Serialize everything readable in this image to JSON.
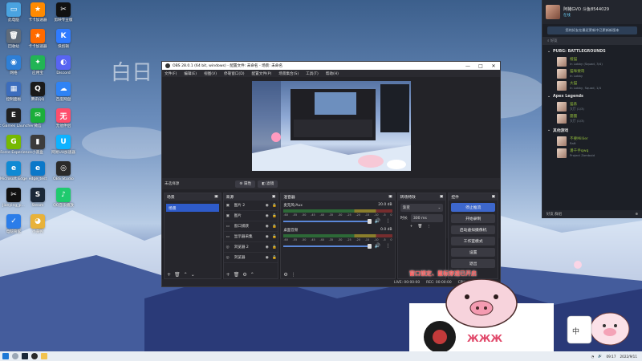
{
  "desktop": {
    "icons": [
      {
        "label": "此电脑",
        "color": "#4aa3e0",
        "glyph": "▭"
      },
      {
        "label": "卡卡加速器",
        "color": "#ff8a00",
        "glyph": "★"
      },
      {
        "label": "剪映专业版",
        "color": "#111111",
        "glyph": "✂"
      },
      {
        "label": "回收站",
        "color": "#5f6b7a",
        "glyph": "🗑"
      },
      {
        "label": "卡卡加速器",
        "color": "#ff6a00",
        "glyph": "★"
      },
      {
        "label": "快剪辑",
        "color": "#2f7bff",
        "glyph": "K"
      },
      {
        "label": "网络",
        "color": "#2e7fd6",
        "glyph": "◉"
      },
      {
        "label": "应用宝",
        "color": "#22b455",
        "glyph": "✦"
      },
      {
        "label": "Discord",
        "color": "#5865f2",
        "glyph": "◐"
      },
      {
        "label": "控制面板",
        "color": "#3c6dbd",
        "glyph": "▦"
      },
      {
        "label": "腾讯QQ",
        "color": "#1a1a1a",
        "glyph": "Q"
      },
      {
        "label": "百度网盘",
        "color": "#2f83f5",
        "glyph": "☁"
      },
      {
        "label": "Epic Games Launcher",
        "color": "#202020",
        "glyph": "E"
      },
      {
        "label": "微信",
        "color": "#1bae3a",
        "glyph": "✉"
      },
      {
        "label": "无他伴侣",
        "color": "#ff4d6b",
        "glyph": "无"
      },
      {
        "label": "GeForce Experience",
        "color": "#76b900",
        "glyph": "G"
      },
      {
        "label": "小黑盒",
        "color": "#3c3c3c",
        "glyph": "▮"
      },
      {
        "label": "网易UU加速器",
        "color": "#0db2ff",
        "glyph": "U"
      },
      {
        "label": "Microsoft Edge",
        "color": "#0f8ad4",
        "glyph": "e"
      },
      {
        "label": "edge_test",
        "color": "#0a78c9",
        "glyph": "e"
      },
      {
        "label": "OBS Studio",
        "color": "#2a2a2a",
        "glyph": "◎"
      },
      {
        "label": "Jianying_p...",
        "color": "#111111",
        "glyph": "✂"
      },
      {
        "label": "Steam",
        "color": "#1b2838",
        "glyph": "S"
      },
      {
        "label": "QQ音乐播放",
        "color": "#1fca6e",
        "glyph": "♪"
      },
      {
        "label": "电脑管家",
        "color": "#2b7de9",
        "glyph": "✓"
      },
      {
        "label": "小黄鸭",
        "color": "#e8b23a",
        "glyph": "◕"
      }
    ],
    "brand": "白日"
  },
  "obs": {
    "title": "OBS 28.0.1 (64 bit, windows) - 配置文件: 未命名 - 场景: 未命名",
    "window_controls": [
      "—",
      "□",
      "✕"
    ],
    "menus": [
      "文件(F)",
      "编辑(E)",
      "视图(V)",
      "停靠窗口(D)",
      "配置文件(P)",
      "场景集合(S)",
      "工具(T)",
      "帮助(H)"
    ],
    "no_source": "未选择源",
    "properties_label": "属性",
    "filters_label": "滤镜",
    "scenes": {
      "title": "场景",
      "items": [
        "场景"
      ]
    },
    "sources": {
      "title": "来源",
      "items": [
        {
          "name": "图片 2",
          "icon": "▣"
        },
        {
          "name": "图片",
          "icon": "▣"
        },
        {
          "name": "窗口捕获",
          "icon": "▭"
        },
        {
          "name": "显示器采集",
          "icon": "▭"
        },
        {
          "name": "浏览器 2",
          "icon": "◎"
        },
        {
          "name": "浏览器",
          "icon": "◎"
        }
      ]
    },
    "mixer": {
      "title": "混音器",
      "channels": [
        {
          "name": "麦克风/Aux",
          "db": "20.0 dB"
        },
        {
          "name": "桌面音频",
          "db": "0.0 dB"
        }
      ],
      "ticks": [
        "-60",
        "-55",
        "-50",
        "-45",
        "-40",
        "-35",
        "-30",
        "-25",
        "-20",
        "-15",
        "-10",
        "-5",
        "0"
      ]
    },
    "transitions": {
      "title": "转场特效",
      "selected": "渐变",
      "duration_label": "时长",
      "duration": "300 ms"
    },
    "controls": {
      "title": "控件",
      "buttons": [
        "停止推流",
        "开始录制",
        "启动虚拟摄像机",
        "工作室模式",
        "设置",
        "退出"
      ]
    },
    "status": {
      "live": "LIVE: 00:00:00",
      "rec": "REC: 00:00:00",
      "cpu": "CPU: 1.2%, 30.00 fps"
    }
  },
  "steam": {
    "username": "阿猪GVO 斗鱼8544029",
    "status": "在线",
    "notice": "您的好友在最近更新中已更新新版本",
    "search_placeholder": "好友",
    "groups": [
      {
        "title": "PUBG: BATTLEGROUNDS",
        "friends": [
          {
            "name": "橙猫",
            "status": "In Lobby (Squad, 3/4)"
          },
          {
            "name": "猫咪要哥",
            "status": "In Lobby"
          },
          {
            "name": "大猫",
            "status": "In Lobby, Squad, 1/4"
          }
        ]
      },
      {
        "title": "Apex Legends",
        "friends": [
          {
            "name": "猫系",
            "status": "大厅 (1/3)"
          },
          {
            "name": "團團",
            "status": "大厅 (1/3)"
          }
        ]
      },
      {
        "title": "其他游戏",
        "friends": [
          {
            "name": "不要Millier",
            "status": "Raft"
          },
          {
            "name": "潘千手qwq",
            "status": "Project Zomboid"
          }
        ]
      }
    ],
    "footer": "好友 群组"
  },
  "overlay": {
    "caption": "窗口锁定、鼠标穿透已开启"
  },
  "taskbar": {
    "time": "09:17",
    "date": "2022/9/11"
  }
}
